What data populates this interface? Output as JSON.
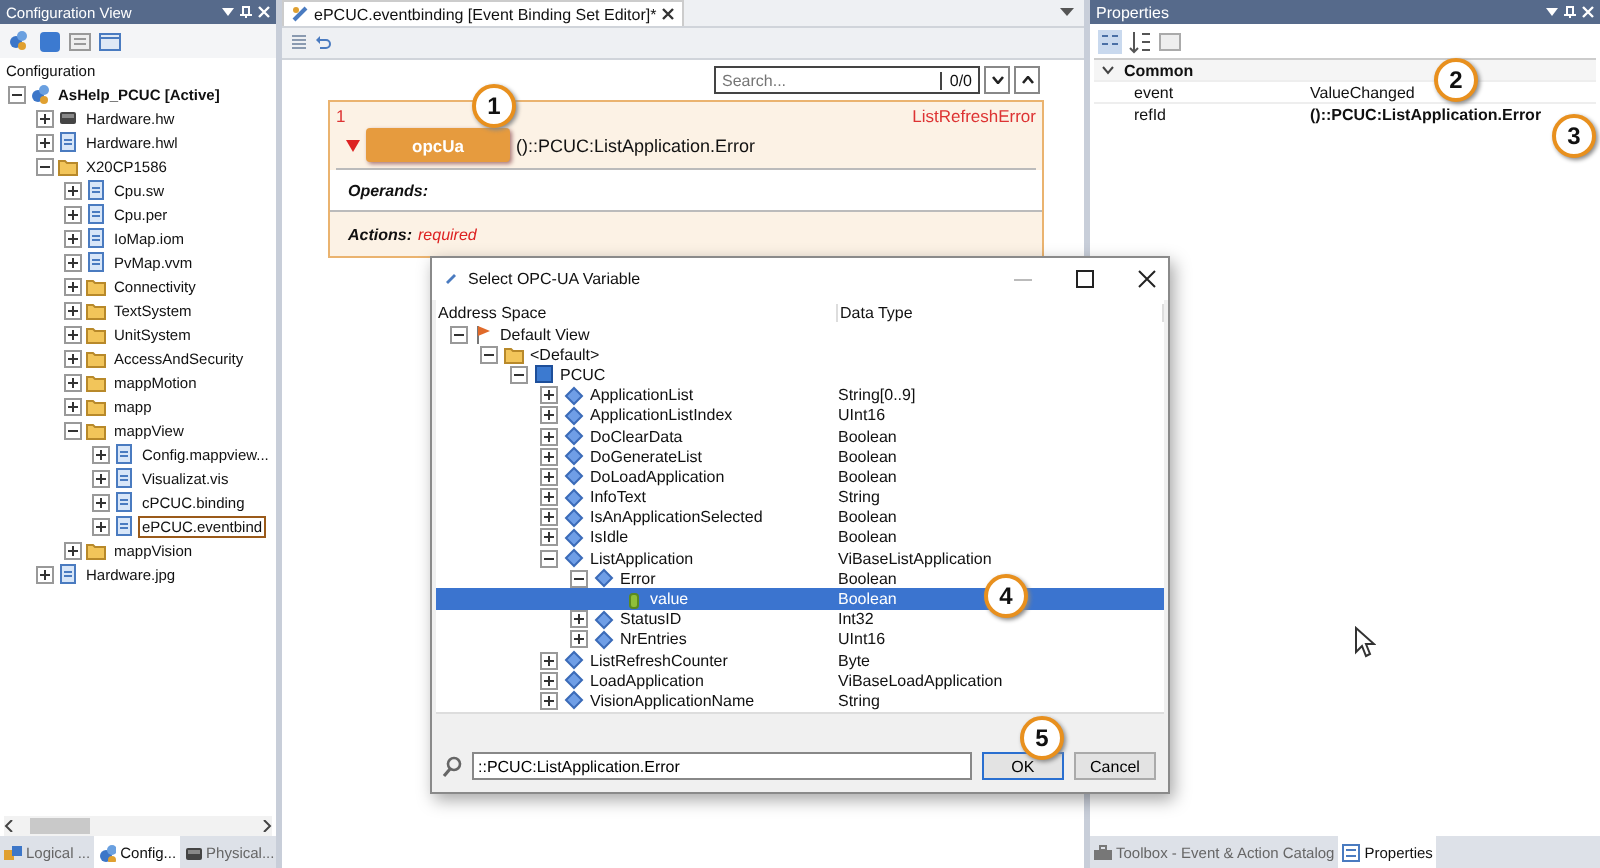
{
  "config_view": {
    "title": "Configuration View",
    "root_label": "Configuration",
    "tree": [
      {
        "label": "AsHelp_PCUC [Active]",
        "kind": "project",
        "expanded": true,
        "selected": false,
        "active": true,
        "children": [
          {
            "label": "Hardware.hw",
            "kind": "device",
            "expanded": false,
            "selected": false,
            "active": false
          },
          {
            "label": "Hardware.hwl",
            "kind": "file",
            "expanded": false,
            "selected": false,
            "active": false
          },
          {
            "label": "X20CP1586",
            "kind": "folder",
            "expanded": true,
            "selected": false,
            "active": false,
            "children": [
              {
                "label": "Cpu.sw",
                "kind": "file",
                "expanded": false,
                "selected": false,
                "active": false
              },
              {
                "label": "Cpu.per",
                "kind": "file",
                "expanded": false,
                "selected": false,
                "active": false
              },
              {
                "label": "IoMap.iom",
                "kind": "file",
                "expanded": false,
                "selected": false,
                "active": false
              },
              {
                "label": "PvMap.vvm",
                "kind": "file",
                "expanded": false,
                "selected": false,
                "active": false
              },
              {
                "label": "Connectivity",
                "kind": "folder",
                "expanded": false,
                "selected": false,
                "active": false
              },
              {
                "label": "TextSystem",
                "kind": "folder",
                "expanded": false,
                "selected": false,
                "active": false
              },
              {
                "label": "UnitSystem",
                "kind": "folder",
                "expanded": false,
                "selected": false,
                "active": false
              },
              {
                "label": "AccessAndSecurity",
                "kind": "folder",
                "expanded": false,
                "selected": false,
                "active": false
              },
              {
                "label": "mappMotion",
                "kind": "folder",
                "expanded": false,
                "selected": false,
                "active": false
              },
              {
                "label": "mapp",
                "kind": "folder",
                "expanded": false,
                "selected": false,
                "active": false
              },
              {
                "label": "mappView",
                "kind": "folder",
                "expanded": true,
                "selected": false,
                "active": false,
                "children": [
                  {
                    "label": "Config.mappview...",
                    "kind": "file",
                    "expanded": false,
                    "selected": false,
                    "active": false
                  },
                  {
                    "label": "Visualizat.vis",
                    "kind": "file",
                    "expanded": false,
                    "selected": false,
                    "active": false
                  },
                  {
                    "label": "cPCUC.binding",
                    "kind": "file",
                    "expanded": false,
                    "selected": false,
                    "active": false
                  },
                  {
                    "label": "ePCUC.eventbind",
                    "kind": "file",
                    "expanded": false,
                    "selected": true,
                    "active": false
                  }
                ]
              },
              {
                "label": "mappVision",
                "kind": "folder",
                "expanded": false,
                "selected": false,
                "active": false
              }
            ]
          },
          {
            "label": "Hardware.jpg",
            "kind": "file",
            "expanded": false,
            "selected": false,
            "active": false
          }
        ]
      }
    ],
    "tabs": [
      {
        "label": "Logical ...",
        "selected": false
      },
      {
        "label": "Config...",
        "selected": true
      },
      {
        "label": "Physical...",
        "selected": false
      }
    ]
  },
  "editor": {
    "tab": "ePCUC.eventbinding [Event Binding Set Editor]*",
    "search": {
      "placeholder": "Search...",
      "count": "0/0"
    },
    "binding": {
      "index": "1",
      "name": "ListRefreshError",
      "expanded": true,
      "source_type": "opcUa",
      "source": "()::PCUC:ListApplication.Error",
      "operands_label": "Operands:",
      "actions_label": "Actions:",
      "actions_status": "required"
    }
  },
  "properties": {
    "title": "Properties",
    "category": "Common",
    "expanded": true,
    "rows": [
      {
        "name": "event",
        "value": "ValueChanged",
        "bold": false
      },
      {
        "name": "refId",
        "value": "()::PCUC:ListApplication.Error",
        "bold": true
      }
    ]
  },
  "bottom_tabs": [
    {
      "label": "Toolbox - Event & Action Catalog",
      "selected": false
    },
    {
      "label": "Properties",
      "selected": true
    }
  ],
  "dialog": {
    "title": "Select OPC-UA Variable",
    "columns": [
      "Address Space",
      "Data Type"
    ],
    "tree": [
      {
        "label": "Default View",
        "kind": "view",
        "expanded": true,
        "selected": false,
        "children": [
          {
            "label": "<Default>",
            "kind": "folder",
            "expanded": true,
            "selected": false,
            "children": [
              {
                "label": "PCUC",
                "kind": "object",
                "expanded": true,
                "selected": false,
                "children": [
                  {
                    "label": "ApplicationList",
                    "type": "String[0..9]",
                    "kind": "variable",
                    "expanded": false,
                    "selected": false
                  },
                  {
                    "label": "ApplicationListIndex",
                    "type": "UInt16",
                    "kind": "variable",
                    "expanded": false,
                    "selected": false
                  },
                  {
                    "label": "DoClearData",
                    "type": "Boolean",
                    "kind": "variable",
                    "expanded": false,
                    "selected": false
                  },
                  {
                    "label": "DoGenerateList",
                    "type": "Boolean",
                    "kind": "variable",
                    "expanded": false,
                    "selected": false
                  },
                  {
                    "label": "DoLoadApplication",
                    "type": "Boolean",
                    "kind": "variable",
                    "expanded": false,
                    "selected": false
                  },
                  {
                    "label": "InfoText",
                    "type": "String",
                    "kind": "variable",
                    "expanded": false,
                    "selected": false
                  },
                  {
                    "label": "IsAnApplicationSelected",
                    "type": "Boolean",
                    "kind": "variable",
                    "expanded": false,
                    "selected": false
                  },
                  {
                    "label": "IsIdle",
                    "type": "Boolean",
                    "kind": "variable",
                    "expanded": false,
                    "selected": false
                  },
                  {
                    "label": "ListApplication",
                    "type": "ViBaseListApplication",
                    "kind": "variable",
                    "expanded": true,
                    "selected": false,
                    "children": [
                      {
                        "label": "Error",
                        "type": "Boolean",
                        "kind": "variable",
                        "expanded": true,
                        "selected": false,
                        "children": [
                          {
                            "label": "value",
                            "type": "Boolean",
                            "kind": "value",
                            "selected": true
                          }
                        ]
                      },
                      {
                        "label": "StatusID",
                        "type": "Int32",
                        "kind": "variable",
                        "expanded": false,
                        "selected": false
                      },
                      {
                        "label": "NrEntries",
                        "type": "UInt16",
                        "kind": "variable",
                        "expanded": false,
                        "selected": false
                      }
                    ]
                  },
                  {
                    "label": "ListRefreshCounter",
                    "type": "Byte",
                    "kind": "variable",
                    "expanded": false,
                    "selected": false
                  },
                  {
                    "label": "LoadApplication",
                    "type": "ViBaseLoadApplication",
                    "kind": "variable",
                    "expanded": false,
                    "selected": false
                  },
                  {
                    "label": "VisionApplicationName",
                    "type": "String",
                    "kind": "variable",
                    "expanded": false,
                    "selected": false
                  }
                ]
              }
            ]
          }
        ]
      }
    ],
    "path": "::PCUC:ListApplication.Error",
    "buttons": [
      {
        "label": "OK",
        "kind": "default"
      },
      {
        "label": "Cancel",
        "kind": "normal"
      }
    ]
  },
  "callouts": [
    "1",
    "2",
    "3",
    "4",
    "5"
  ]
}
